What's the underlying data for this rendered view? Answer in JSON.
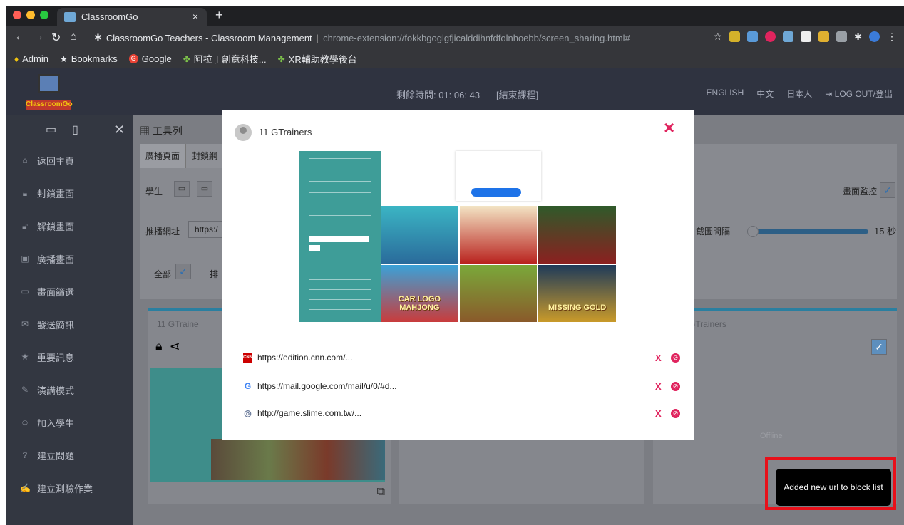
{
  "browser": {
    "tab_title": "ClassroomGo",
    "tab_close": "×",
    "new_tab": "+",
    "page_title": "ClassroomGo Teachers - Classroom Management",
    "url": "chrome-extension://fokkbgoglgfjicalddihnfdfolnhoebb/screen_sharing.html#",
    "bookmarks": [
      {
        "label": "Admin",
        "icon": "admin-icon"
      },
      {
        "label": "Bookmarks",
        "icon": "star-icon"
      },
      {
        "label": "Google",
        "icon": "google-icon"
      },
      {
        "label": "阿拉丁創意科技...",
        "icon": "puzzle-icon"
      },
      {
        "label": "XR輔助教學後台",
        "icon": "puzzle-icon"
      }
    ]
  },
  "header": {
    "logo_text": "ClassroomGo",
    "timer": "剩餘時間: 01: 06: 43",
    "end_course": "[結束課程]",
    "languages": [
      "ENGLISH",
      "中文",
      "日本人"
    ],
    "logout": "LOG OUT/登出"
  },
  "sidebar": {
    "items": [
      {
        "label": "返回主頁",
        "icon": "home-icon"
      },
      {
        "label": "封鎖畫面",
        "icon": "lock-icon"
      },
      {
        "label": "解鎖畫面",
        "icon": "unlock-icon"
      },
      {
        "label": "廣播畫面",
        "icon": "broadcast-icon"
      },
      {
        "label": "畫面篩選",
        "icon": "screen-filter-icon"
      },
      {
        "label": "發送簡訊",
        "icon": "message-icon"
      },
      {
        "label": "重要訊息",
        "icon": "star-icon"
      },
      {
        "label": "演講模式",
        "icon": "presentation-icon"
      },
      {
        "label": "加入學生",
        "icon": "add-student-icon"
      },
      {
        "label": "建立問題",
        "icon": "question-icon"
      },
      {
        "label": "建立測驗作業",
        "icon": "quiz-icon"
      }
    ]
  },
  "main": {
    "toolbar_title": "工具列",
    "tabs": [
      "廣播頁面",
      "封鎖網"
    ],
    "student_label": "學生",
    "push_url_label": "推播網址",
    "push_url_value": "https:/",
    "all_label": "全部",
    "sort_label": "排",
    "screen_monitor_label": "畫面監控",
    "capture_interval_label": "截圖間隔",
    "capture_interval_value": "15 秒",
    "card_user": "11 GTraine",
    "card_user_right": "GTrainers",
    "offline_label": "Offline"
  },
  "modal": {
    "user": "11 GTrainers",
    "close": "×",
    "urls": [
      {
        "url": "https://edition.cnn.com/...",
        "icon": "cnn-icon"
      },
      {
        "url": "https://mail.google.com/mail/u/0/#d...",
        "icon": "google-icon"
      },
      {
        "url": "http://game.slime.com.tw/...",
        "icon": "globe-icon"
      }
    ],
    "delete_label": "X",
    "game_tiles": [
      "",
      "",
      "",
      "CAR LOGO MAHJONG",
      "",
      "MISSING GOLD"
    ]
  },
  "toast": {
    "message": "Added new url to block list"
  },
  "colors": {
    "accent": "#2a7fa0",
    "danger": "#e0245e",
    "highlight_border": "#e8101a"
  }
}
